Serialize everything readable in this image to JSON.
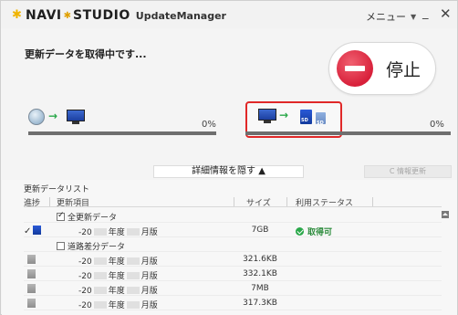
{
  "window": {
    "brand_left": "NAVI",
    "brand_right": "STUDIO",
    "subtitle": "UpdateManager",
    "menu_label": "メニュー",
    "minimize_glyph": "_",
    "close_glyph": "✕"
  },
  "status": {
    "message": "更新データを取得中です...",
    "stop_label": "停止",
    "left_percent": "0%",
    "right_percent": "0%",
    "left_progress": 0,
    "right_progress": 0
  },
  "toggle": {
    "detail_label": "詳細情報を隠す ▲",
    "refresh_label": "C 情報更新"
  },
  "list": {
    "title": "更新データリスト",
    "headers": {
      "progress": "進捗",
      "item": "更新項目",
      "size": "サイズ",
      "status": "利用ステータス"
    },
    "rows": [
      {
        "kind": "group",
        "checked": true,
        "label": "全更新データ",
        "size": "",
        "status": ""
      },
      {
        "kind": "full",
        "done": true,
        "prefix": "-20",
        "mid": "年度",
        "suffix": "月版",
        "size": "7GB",
        "status": "取得可"
      },
      {
        "kind": "group",
        "checked": false,
        "label": "道路差分データ",
        "size": "",
        "status": ""
      },
      {
        "kind": "diff",
        "prefix": "-20",
        "mid": "年度",
        "suffix": "月版",
        "size": "321.6KB",
        "status": ""
      },
      {
        "kind": "diff",
        "prefix": "-20",
        "mid": "年度",
        "suffix": "月版",
        "size": "332.1KB",
        "status": ""
      },
      {
        "kind": "diff",
        "prefix": "-20",
        "mid": "年度",
        "suffix": "月版",
        "size": "7MB",
        "status": ""
      },
      {
        "kind": "diff",
        "prefix": "-20",
        "mid": "年度",
        "suffix": "月版",
        "size": "317.3KB",
        "status": ""
      }
    ]
  },
  "colors": {
    "progress_track": "#6e6e6e",
    "highlight_border": "#e02828",
    "stop_red": "#d8203a",
    "available_green": "#2aa84a"
  },
  "icons": {
    "title": "star-icon",
    "source": "globe-icon",
    "pc": "pc-icon",
    "target": "sd-card-icon",
    "stop": "stop-icon",
    "available": "available-icon"
  }
}
